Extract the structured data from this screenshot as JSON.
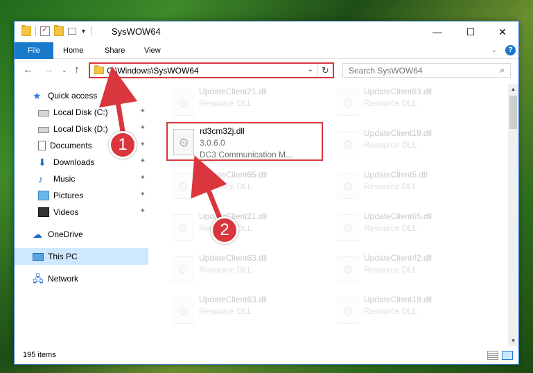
{
  "window": {
    "title": "SysWOW64",
    "controls": {
      "minimize": "—",
      "maximize": "☐",
      "close": "✕"
    }
  },
  "ribbon": {
    "tabs": {
      "file": "File",
      "home": "Home",
      "share": "Share",
      "view": "View"
    },
    "help": "?"
  },
  "navigation": {
    "back": "←",
    "forward": "→",
    "recent": "⌄",
    "up": "↑",
    "address": "C:\\Windows\\SysWOW64",
    "refresh": "↻",
    "search_placeholder": "Search SysWOW64",
    "search_icon": "⌕"
  },
  "sidebar": {
    "items": [
      {
        "label": "Quick access",
        "icon": "star-icon"
      },
      {
        "label": "Local Disk (C:)",
        "icon": "drive-icon"
      },
      {
        "label": "Local Disk (D:)",
        "icon": "drive-icon"
      },
      {
        "label": "Documents",
        "icon": "documents-icon"
      },
      {
        "label": "Downloads",
        "icon": "downloads-icon"
      },
      {
        "label": "Music",
        "icon": "music-icon"
      },
      {
        "label": "Pictures",
        "icon": "pictures-icon"
      },
      {
        "label": "Videos",
        "icon": "videos-icon"
      },
      {
        "label": "OneDrive",
        "icon": "onedrive-icon"
      },
      {
        "label": "This PC",
        "icon": "this-pc-icon"
      },
      {
        "label": "Network",
        "icon": "network-icon"
      }
    ],
    "pin": "📌"
  },
  "files": {
    "highlighted": {
      "name": "rd3cm32j.dll",
      "version": "3.0.6.0",
      "description": "DC3 Communication M..."
    },
    "tiles": [
      {
        "name": "UpdateClient21.dll",
        "desc": "Resource DLL"
      },
      {
        "name": "UpdateClient63.dll",
        "desc": "Resource DLL"
      },
      {
        "name": "UpdateClient19.dll",
        "desc": "Resource DLL"
      },
      {
        "name": "UpdateClient65.dll",
        "desc": "Resource DLL"
      },
      {
        "name": "UpdateClient5.dll",
        "desc": "Resource DLL"
      },
      {
        "name": "UpdateClient21.dll",
        "desc": "Resource DLL"
      },
      {
        "name": "UpdateClient65.dll",
        "desc": "Resource DLL"
      },
      {
        "name": "UpdateClient63.dll",
        "desc": "Resource DLL"
      },
      {
        "name": "UpdateClient42.dll",
        "desc": "Resource DLL"
      },
      {
        "name": "UpdateClient63.dll",
        "desc": "Resource DLL"
      },
      {
        "name": "UpdateClient19.dll",
        "desc": "Resource DLL"
      }
    ]
  },
  "status": {
    "item_count": "195 items"
  },
  "annotations": {
    "step1": "1",
    "step2": "2",
    "color": "#d9363e"
  }
}
